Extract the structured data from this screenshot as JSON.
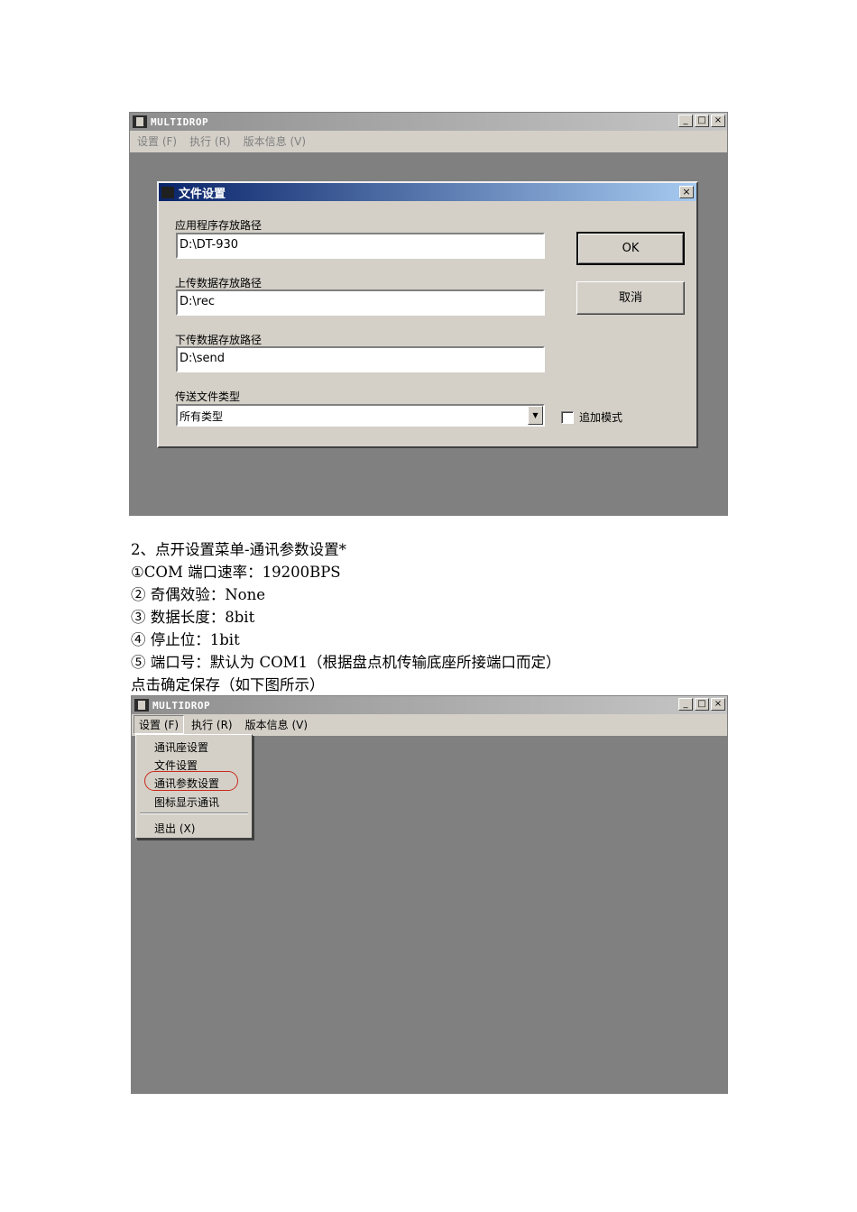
{
  "window1": {
    "title": "MULTIDROP",
    "buttons": {
      "minimize": "_",
      "maximize": "□",
      "close": "×"
    },
    "menu": [
      {
        "label": "设置 (F)"
      },
      {
        "label": "执行 (R)"
      },
      {
        "label": "版本信息 (V)"
      }
    ],
    "dialog": {
      "title": "文件设置",
      "close": "×",
      "app_path_label": "应用程序存放路径",
      "app_path_value": "D:\\DT-930",
      "upload_path_label": "上传数据存放路径",
      "upload_path_value": "D:\\rec",
      "download_path_label": "下传数据存放路径",
      "download_path_value": "D:\\send",
      "file_type_label": "传送文件类型",
      "file_type_value": "所有类型",
      "append_mode_label": "追加模式",
      "ok_label": "OK",
      "cancel_label": "取消"
    }
  },
  "instructions": {
    "heading": "2、点开设置菜单-通讯参数设置*",
    "line1": "①COM 端口速率：19200BPS",
    "line2": "② 奇偶效验：None",
    "line3": "③ 数据长度：8bit",
    "line4": "④ 停止位：1bit",
    "line5": "⑤ 端口号：默认为 COM1（根据盘点机传输底座所接端口而定）",
    "line6": "点击确定保存（如下图所示）"
  },
  "window2": {
    "title": "MULTIDROP",
    "buttons": {
      "minimize": "_",
      "maximize": "□",
      "close": "×"
    },
    "menu": [
      {
        "label": "设置 (F)"
      },
      {
        "label": "执行 (R)"
      },
      {
        "label": "版本信息 (V)"
      }
    ],
    "dropdown": [
      {
        "label": "通讯座设置"
      },
      {
        "label": "文件设置"
      },
      {
        "label": "通讯参数设置"
      },
      {
        "label": "图标显示通讯"
      },
      {
        "label": "退出 (X)"
      }
    ],
    "highlight_color": "#cc2a1a"
  }
}
